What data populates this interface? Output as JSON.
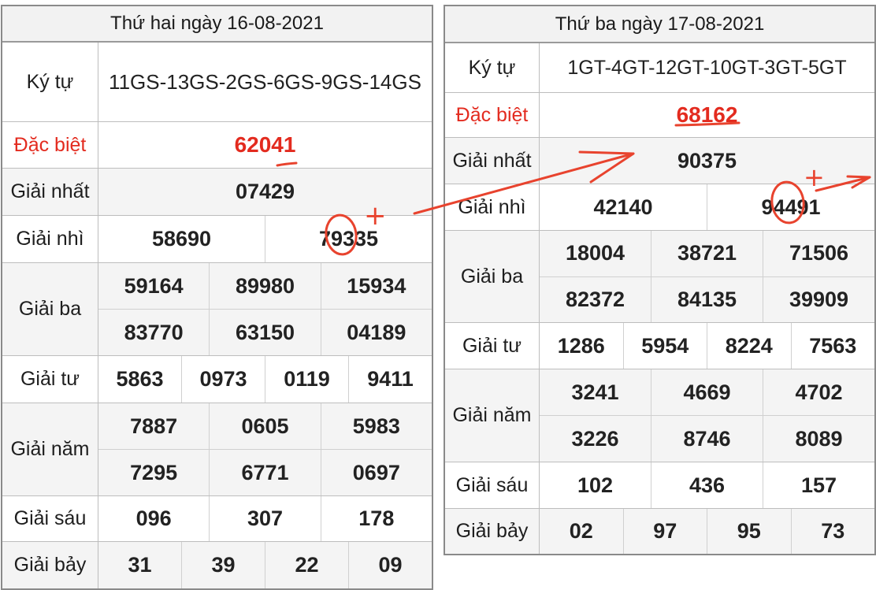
{
  "left": {
    "title": "Thứ hai ngày 16-08-2021",
    "ky_tu": {
      "label": "Ký tự",
      "value": "11GS-13GS-2GS-6GS-9GS-14GS"
    },
    "dac_biet": {
      "label": "Đặc biệt",
      "value": "62041"
    },
    "giai_nhat": {
      "label": "Giải nhất",
      "values": [
        "07429"
      ]
    },
    "giai_nhi": {
      "label": "Giải nhì",
      "values": [
        "58690",
        "79335"
      ]
    },
    "giai_ba": {
      "label": "Giải ba",
      "values": [
        "59164",
        "89980",
        "15934",
        "83770",
        "63150",
        "04189"
      ]
    },
    "giai_tu": {
      "label": "Giải tư",
      "values": [
        "5863",
        "0973",
        "0119",
        "9411"
      ]
    },
    "giai_nam": {
      "label": "Giải năm",
      "values": [
        "7887",
        "0605",
        "5983",
        "7295",
        "6771",
        "0697"
      ]
    },
    "giai_sau": {
      "label": "Giải sáu",
      "values": [
        "096",
        "307",
        "178"
      ]
    },
    "giai_bay": {
      "label": "Giải bảy",
      "values": [
        "31",
        "39",
        "22",
        "09"
      ]
    }
  },
  "right": {
    "title": "Thứ ba ngày 17-08-2021",
    "ky_tu": {
      "label": "Ký tự",
      "value": "1GT-4GT-12GT-10GT-3GT-5GT"
    },
    "dac_biet": {
      "label": "Đặc biệt",
      "value": "68162"
    },
    "giai_nhat": {
      "label": "Giải nhất",
      "values": [
        "90375"
      ]
    },
    "giai_nhi": {
      "label": "Giải nhì",
      "values": [
        "42140",
        "94491"
      ]
    },
    "giai_ba": {
      "label": "Giải ba",
      "values": [
        "18004",
        "38721",
        "71506",
        "82372",
        "84135",
        "39909"
      ]
    },
    "giai_tu": {
      "label": "Giải tư",
      "values": [
        "1286",
        "5954",
        "8224",
        "7563"
      ]
    },
    "giai_nam": {
      "label": "Giải năm",
      "values": [
        "3241",
        "4669",
        "4702",
        "3226",
        "8746",
        "8089"
      ]
    },
    "giai_sau": {
      "label": "Giải sáu",
      "values": [
        "102",
        "436",
        "157"
      ]
    },
    "giai_bay": {
      "label": "Giải bảy",
      "values": [
        "02",
        "97",
        "95",
        "73"
      ]
    }
  },
  "annotations": {
    "plus_symbol": "+",
    "ink_color": "#e8432e"
  },
  "colors": {
    "red_text": "#e32b1f",
    "border": "#8a8a8a"
  }
}
